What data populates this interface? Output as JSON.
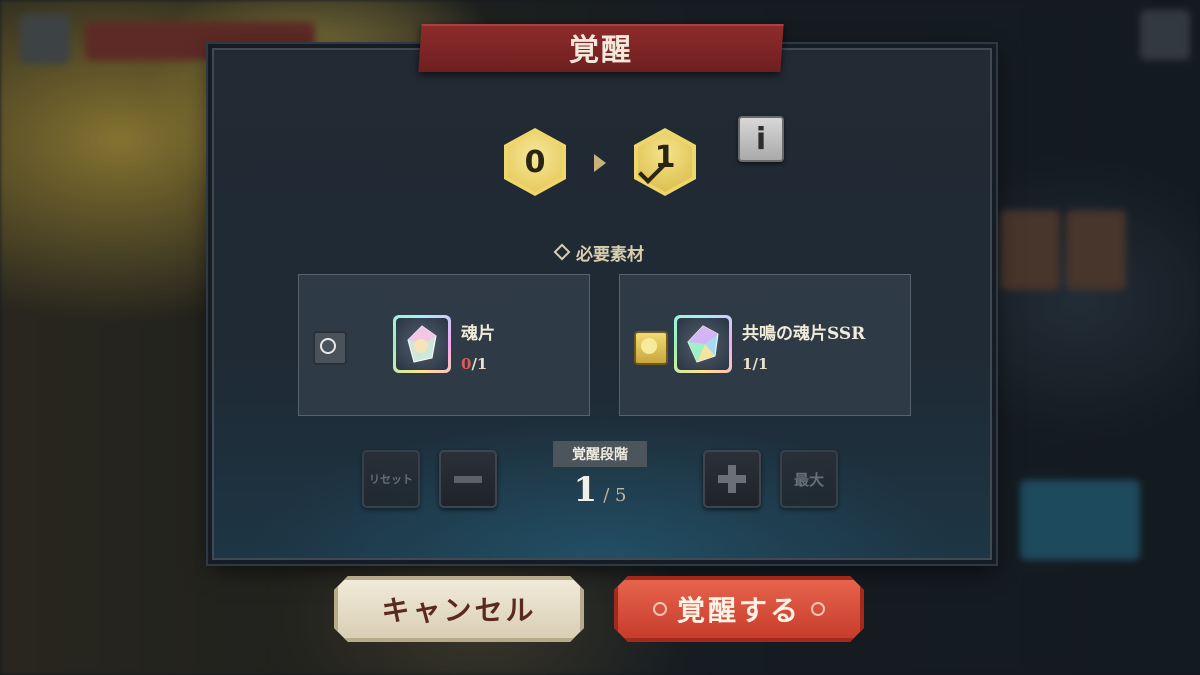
{
  "dialog": {
    "title": "覚醒",
    "level_from": "0",
    "level_to": "1",
    "info_label": "i",
    "required_materials_label": "必要素材"
  },
  "materials": [
    {
      "name": "魂片",
      "have": "0",
      "need": "1",
      "selected": false,
      "icon": "soul-shard-icon"
    },
    {
      "name": "共鳴の魂片SSR",
      "have": "1",
      "need": "1",
      "selected": true,
      "icon": "resonance-soul-shard-ssr-icon"
    }
  ],
  "stage": {
    "label": "覚醒段階",
    "current": "1",
    "max": "5",
    "reset_label": "リセット",
    "max_label": "最大"
  },
  "buttons": {
    "cancel": "キャンセル",
    "awaken": "覚醒する"
  },
  "colors": {
    "accent_gold": "#efd66a",
    "title_red": "#8e2b2b",
    "awaken_red": "#d64b38",
    "shortage_red": "#e05a52"
  }
}
